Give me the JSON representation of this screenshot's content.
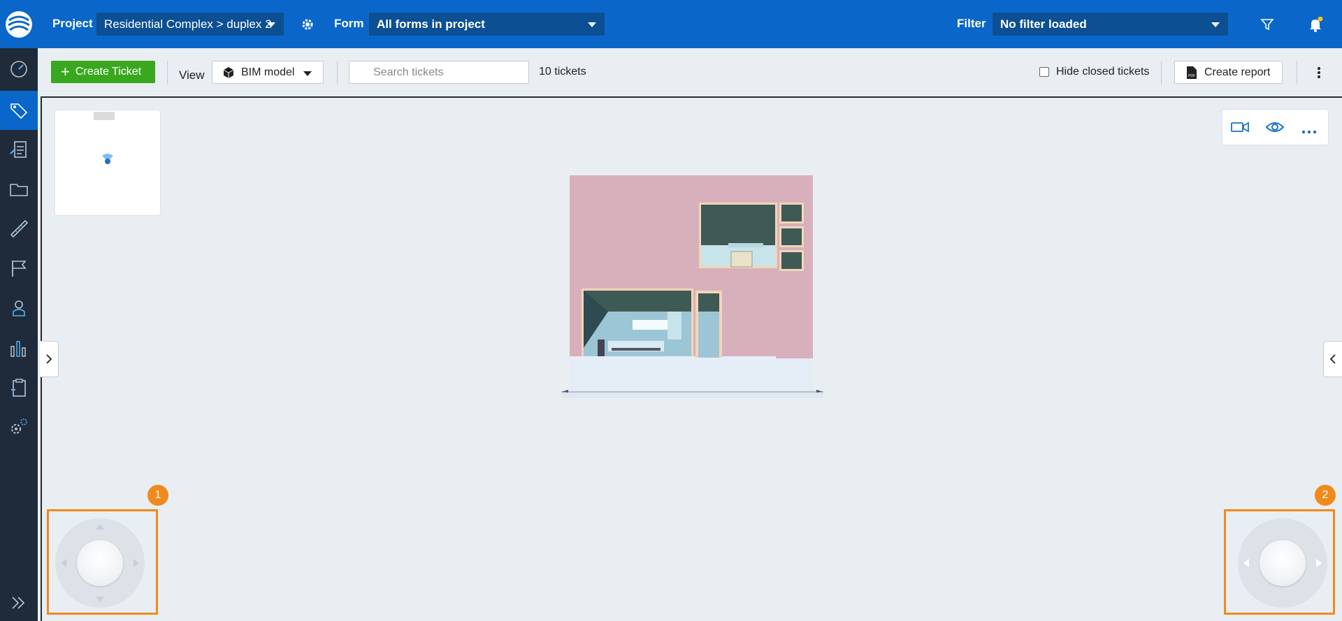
{
  "topbar": {
    "project_label": "Project",
    "project_value": "Residential Complex > duplex 2",
    "form_label": "Form",
    "form_value": "All forms in project",
    "filter_label": "Filter",
    "filter_value": "No filter loaded",
    "notification_dot_color": "#f5c518"
  },
  "sidebar": {
    "items": [
      {
        "icon": "dashboard-gauge-icon"
      },
      {
        "icon": "tags-icon",
        "active": true
      },
      {
        "icon": "forms-document-icon"
      },
      {
        "icon": "folder-icon"
      },
      {
        "icon": "measure-ruler-icon"
      },
      {
        "icon": "flag-icon"
      },
      {
        "icon": "user-contacts-icon"
      },
      {
        "icon": "bar-chart-icon"
      },
      {
        "icon": "clipboard-icon"
      },
      {
        "icon": "settings-gears-icon"
      }
    ],
    "expand_icon": "double-chevron-right-icon"
  },
  "toolbar": {
    "create_ticket": "Create Ticket",
    "view_label": "View",
    "view_value": "BIM model",
    "search_placeholder": "Search tickets",
    "ticket_count": "10 tickets",
    "hide_closed": "Hide closed tickets",
    "create_report": "Create report"
  },
  "viewer": {
    "tools": [
      "video-camera-icon",
      "eye-icon",
      "more-horizontal-icon"
    ],
    "joystick_left_badge": "1",
    "joystick_right_badge": "2"
  },
  "colors": {
    "brand_blue": "#0a66c9",
    "create_green": "#3aa81f",
    "highlight_orange": "#f08a1c",
    "sidebar_dark": "#1f2b3a"
  }
}
